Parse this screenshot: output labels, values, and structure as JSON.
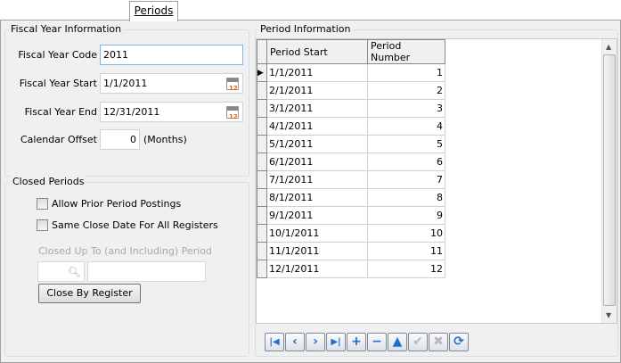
{
  "tabs": [
    {
      "label": "Periods",
      "active": true
    }
  ],
  "fiscal": {
    "title": "Fiscal Year Information",
    "code_label": "Fiscal Year Code",
    "code": "2011",
    "start_label": "Fiscal Year Start",
    "start": "1/1/2011",
    "end_label": "Fiscal Year End",
    "end": "12/31/2011",
    "offset_label": "Calendar Offset",
    "offset": "0",
    "offset_unit": "(Months)"
  },
  "closed": {
    "title": "Closed Periods",
    "allow_prior": "Allow Prior Period Postings",
    "allow_prior_checked": false,
    "same_date": "Same Close Date For All Registers",
    "same_date_checked": false,
    "closed_up_to_label": "Closed Up To (and Including) Period",
    "close_by_register": "Close By Register"
  },
  "period_info": {
    "title": "Period Information",
    "columns": [
      "Period Start",
      "Period Number"
    ],
    "rows": [
      [
        "1/1/2011",
        "1"
      ],
      [
        "2/1/2011",
        "2"
      ],
      [
        "3/1/2011",
        "3"
      ],
      [
        "4/1/2011",
        "4"
      ],
      [
        "5/1/2011",
        "5"
      ],
      [
        "6/1/2011",
        "6"
      ],
      [
        "7/1/2011",
        "7"
      ],
      [
        "8/1/2011",
        "8"
      ],
      [
        "9/1/2011",
        "9"
      ],
      [
        "10/1/2011",
        "10"
      ],
      [
        "11/1/2011",
        "11"
      ],
      [
        "12/1/2011",
        "12"
      ]
    ],
    "current_row": 0
  },
  "navigator": [
    {
      "name": "first-icon",
      "glyph": "|◀",
      "enabled": true
    },
    {
      "name": "prior-icon",
      "glyph": "‹",
      "enabled": true
    },
    {
      "name": "next-icon",
      "glyph": "›",
      "enabled": true
    },
    {
      "name": "last-icon",
      "glyph": "▶|",
      "enabled": true
    },
    {
      "name": "insert-icon",
      "glyph": "+",
      "enabled": true
    },
    {
      "name": "delete-icon",
      "glyph": "−",
      "enabled": true
    },
    {
      "name": "edit-icon",
      "glyph": "▲",
      "enabled": true
    },
    {
      "name": "post-icon",
      "glyph": "✔",
      "enabled": false
    },
    {
      "name": "cancel-icon",
      "glyph": "✖",
      "enabled": false
    },
    {
      "name": "refresh-icon",
      "glyph": "⟳",
      "enabled": true
    }
  ]
}
